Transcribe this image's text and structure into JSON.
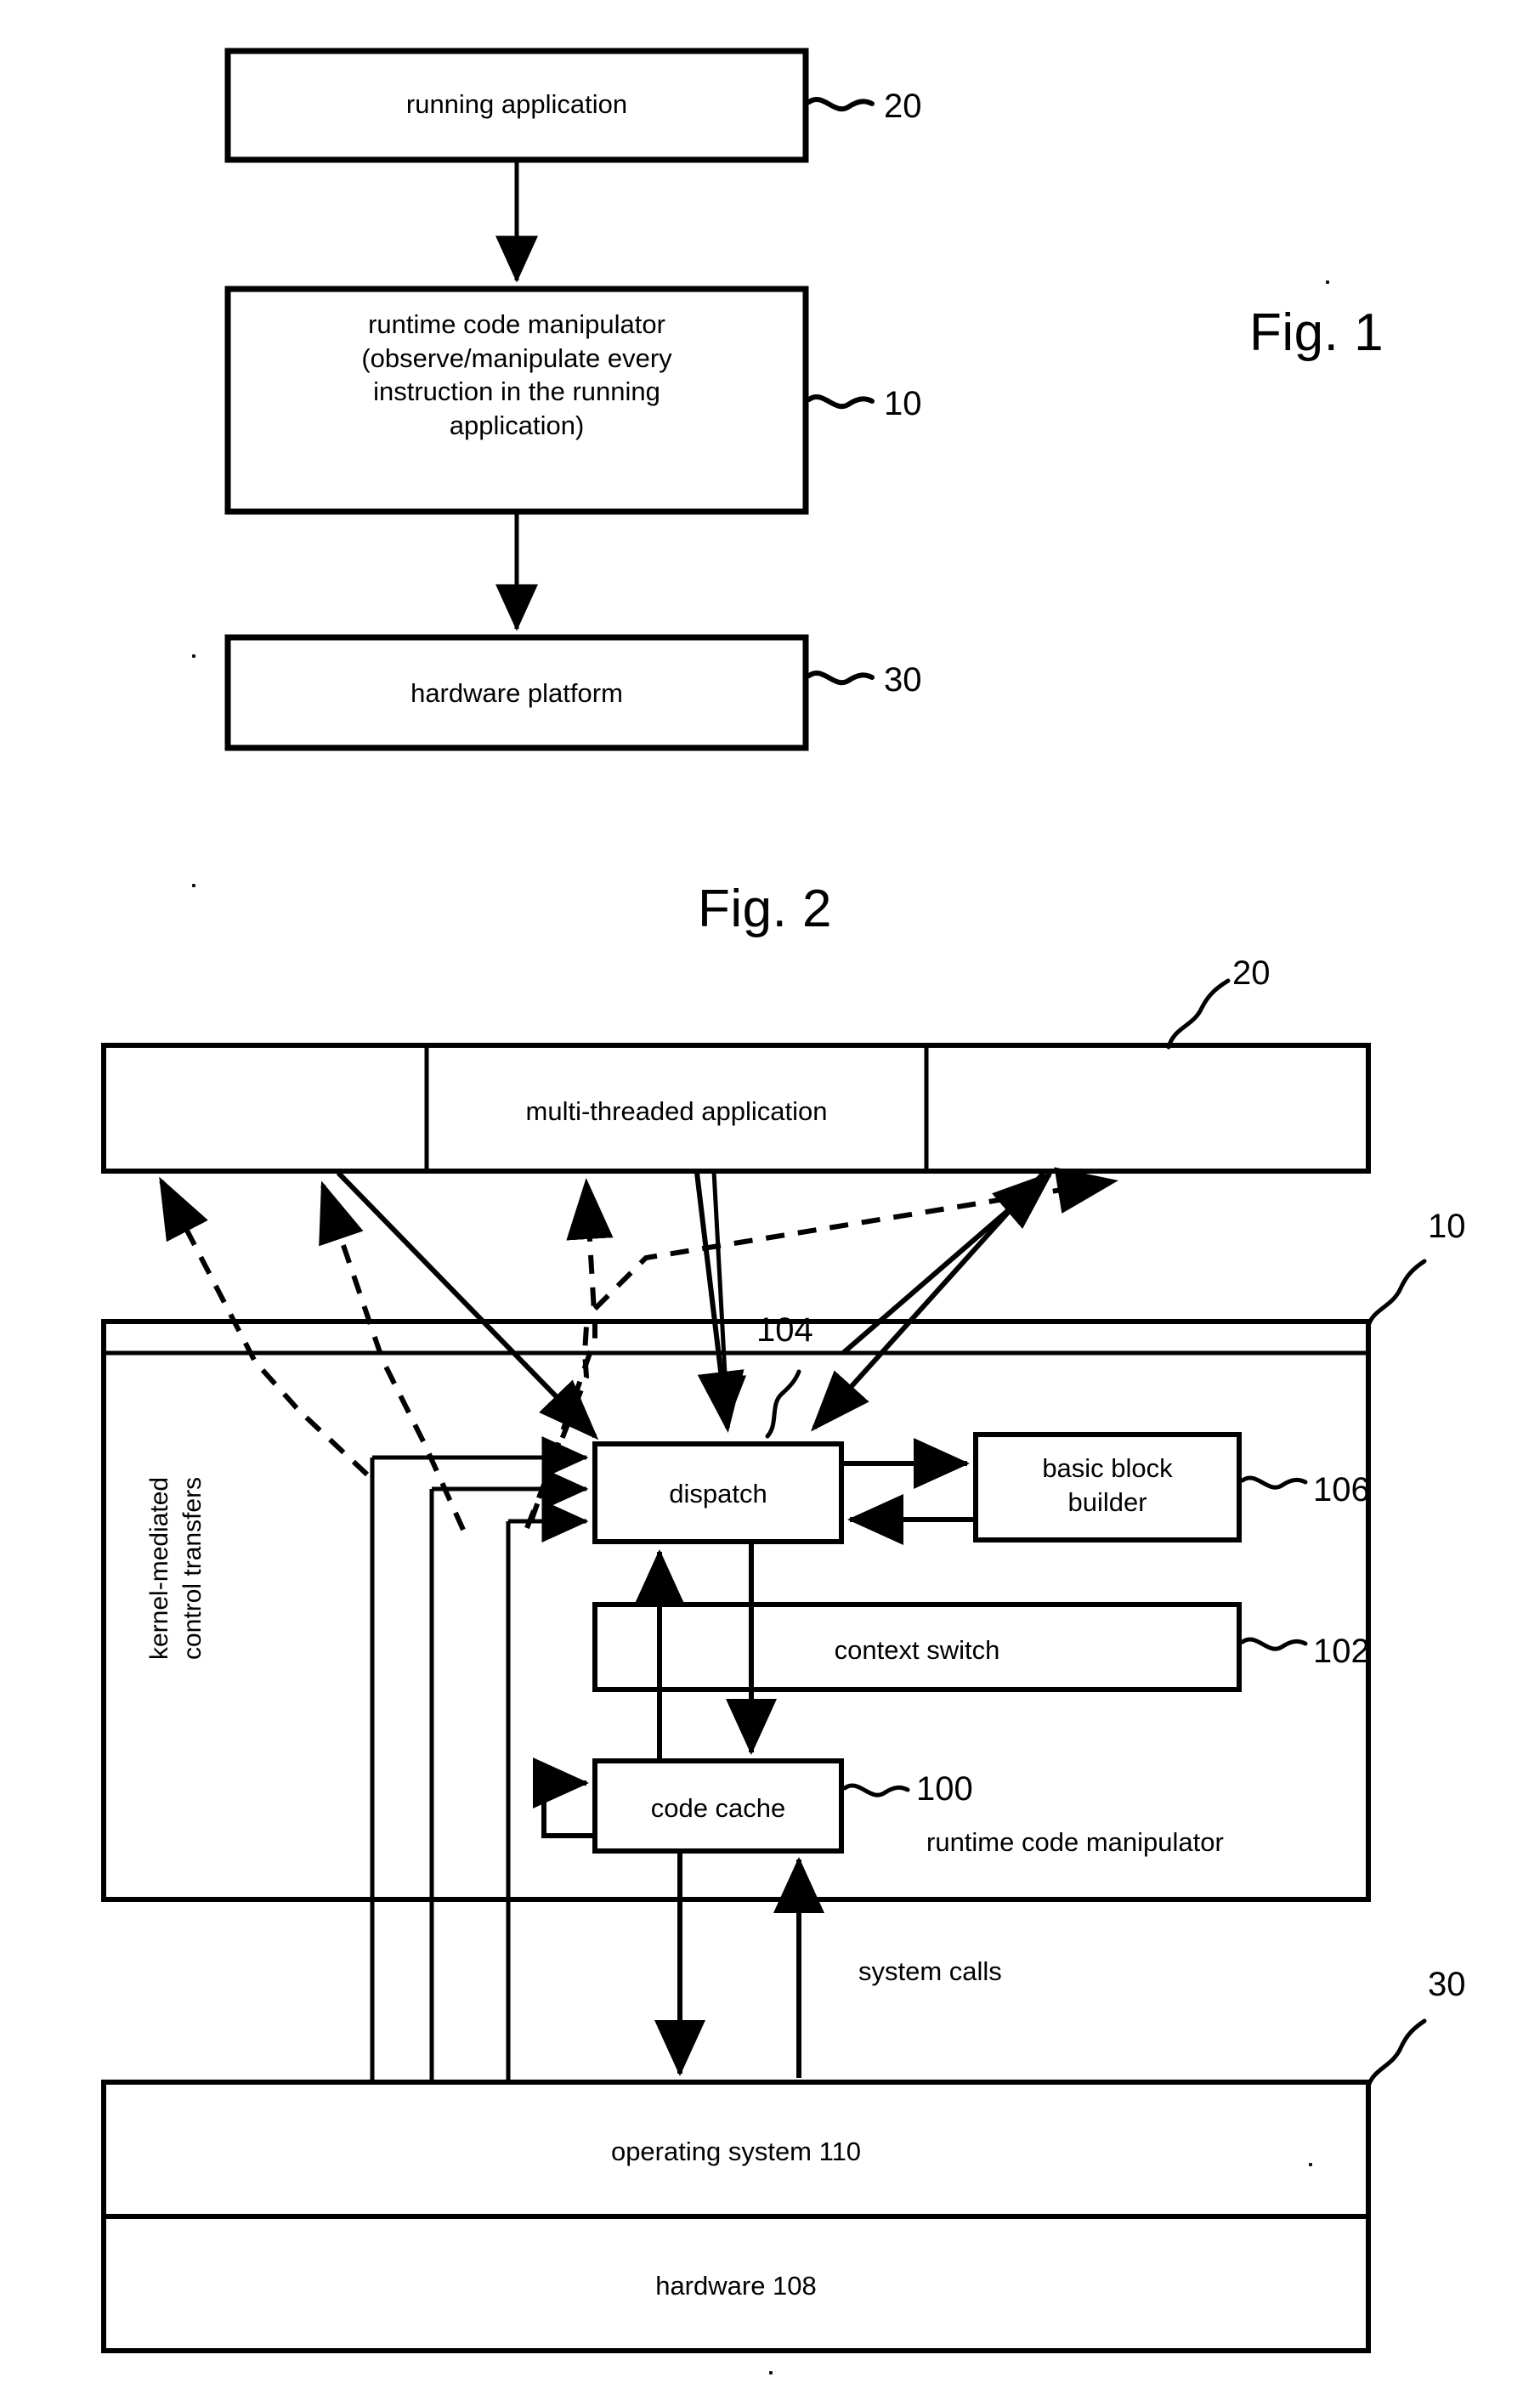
{
  "figure1": {
    "title": "Fig. 1",
    "boxes": [
      {
        "id": "running-application",
        "label": "running application",
        "ref": "20"
      },
      {
        "id": "runtime-code-manipulator",
        "label": "runtime code manipulator\n(observe/manipulate every\ninstruction in the running\napplication)",
        "ref": "10"
      },
      {
        "id": "hardware-platform",
        "label": "hardware platform",
        "ref": "30"
      }
    ],
    "ref_labels": [
      "20",
      "10",
      "30"
    ]
  },
  "figure2": {
    "title": "Fig. 2",
    "application_box": {
      "label": "multi-threaded application",
      "ref": "20"
    },
    "manipulator_box": {
      "ref": "10",
      "caption": "runtime code manipulator",
      "side_label": "kernel-mediated\ncontrol transfers",
      "components": [
        {
          "id": "dispatch",
          "label": "dispatch",
          "ref": "104"
        },
        {
          "id": "basic-block-builder",
          "label": "basic block\nbuilder",
          "ref": "106"
        },
        {
          "id": "context-switch",
          "label": "context switch",
          "ref": "102"
        },
        {
          "id": "code-cache",
          "label": "code cache",
          "ref": "100"
        }
      ]
    },
    "system_calls_label": "system calls",
    "platform_box": {
      "ref": "30",
      "rows": [
        {
          "id": "operating-system",
          "label": "operating system 110"
        },
        {
          "id": "hardware",
          "label": "hardware 108"
        }
      ]
    }
  },
  "colors": {
    "ink": "#000000",
    "paper": "#ffffff"
  }
}
